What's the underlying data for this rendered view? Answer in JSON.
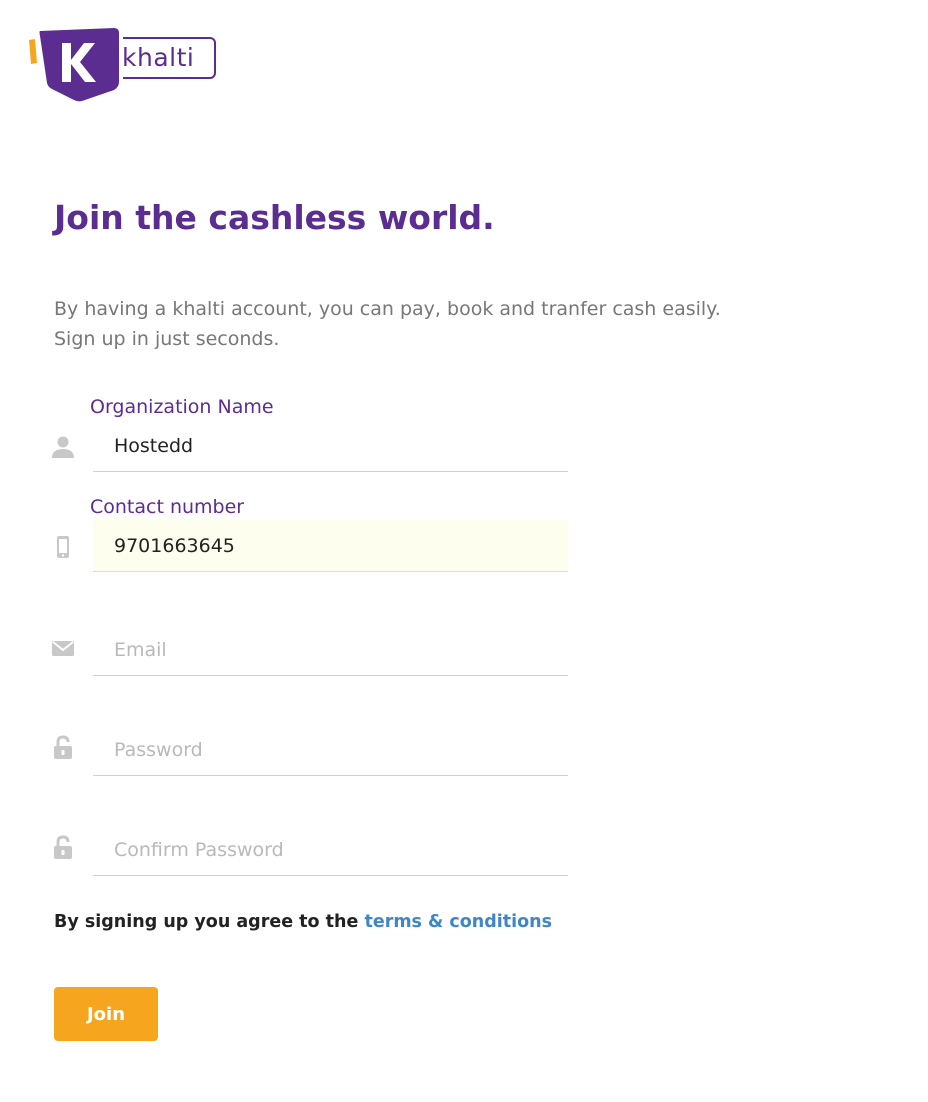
{
  "brand": {
    "logo_letter": "K",
    "logo_word": "khalti",
    "color_primary": "#5c2d91",
    "color_accent": "#f6a61e",
    "color_link": "#3d87c9"
  },
  "hero": {
    "title": "Join the cashless world.",
    "description_line1": "By having a khalti account, you can pay, book and tranfer cash easily.",
    "description_line2": "Sign up in just seconds."
  },
  "form": {
    "organization": {
      "label": "Organization Name",
      "value": "Hostedd",
      "icon": "user-icon"
    },
    "contact": {
      "label": "Contact number",
      "value": "9701663645",
      "icon": "mobile-phone-icon"
    },
    "email": {
      "placeholder": "Email",
      "value": "",
      "icon": "envelope-icon"
    },
    "password": {
      "placeholder": "Password",
      "value": "",
      "icon": "unlock-icon"
    },
    "confirm_password": {
      "placeholder": "Confirm Password",
      "value": "",
      "icon": "unlock-icon"
    }
  },
  "terms": {
    "prefix": "By signing up you agree to the",
    "link_text": "terms & conditions"
  },
  "actions": {
    "join_label": "Join"
  }
}
